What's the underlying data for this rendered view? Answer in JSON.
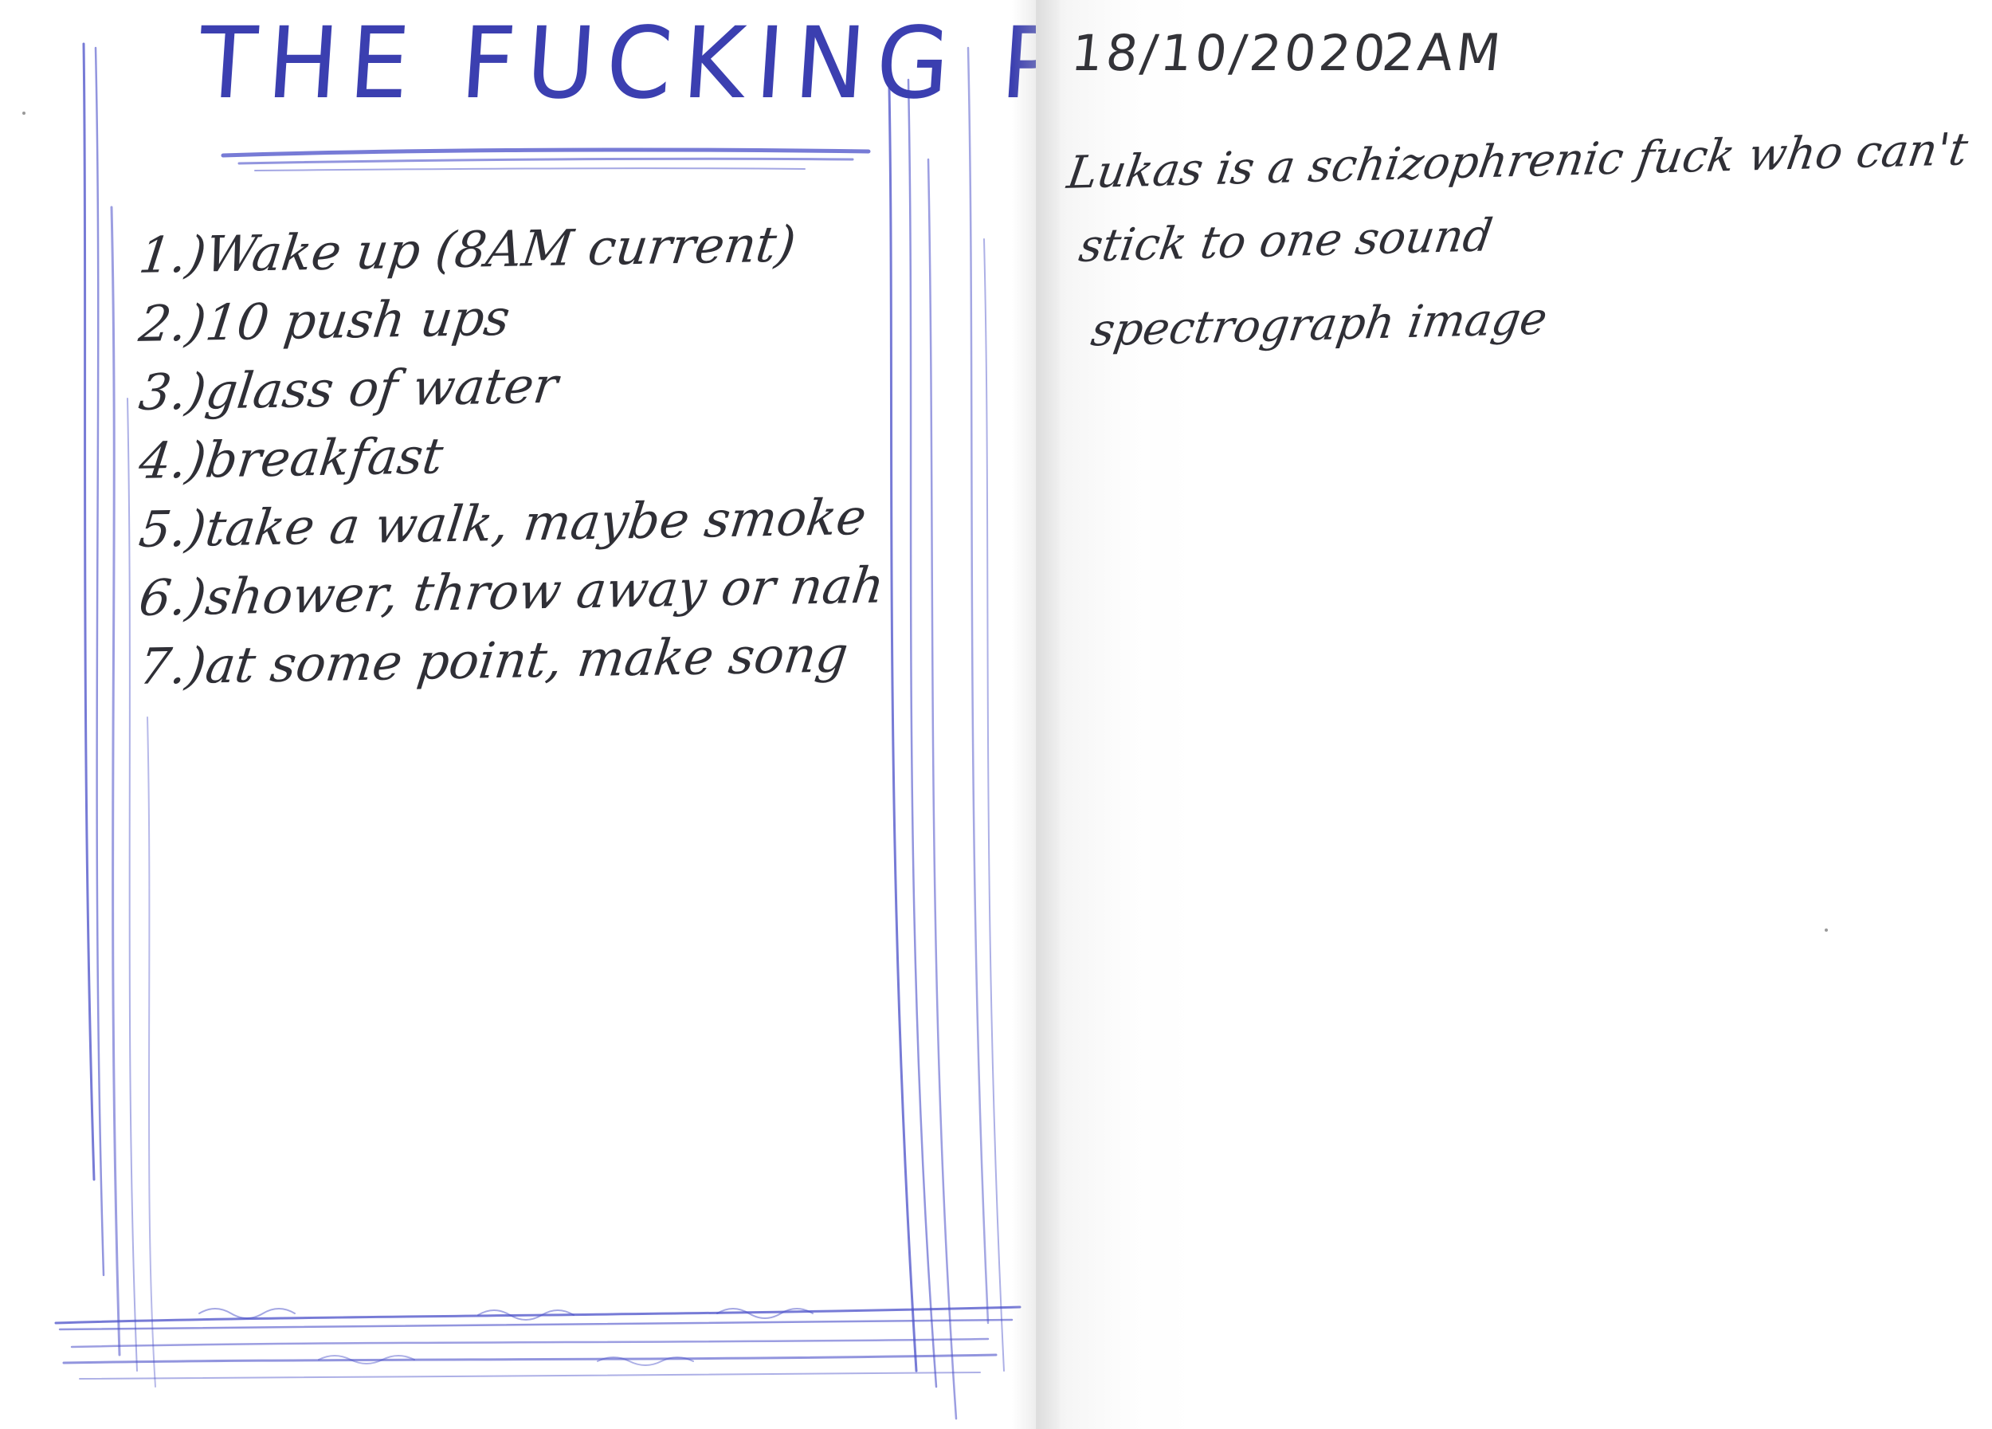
{
  "left_page": {
    "title": "THE FUCKING PLAN",
    "items": [
      {
        "num": "1.)",
        "text": "Wake up (8AM current)"
      },
      {
        "num": "2.)",
        "text": "10 push ups"
      },
      {
        "num": "3.)",
        "text": "glass of water"
      },
      {
        "num": "4.)",
        "text": "breakfast"
      },
      {
        "num": "5.)",
        "text": "take a walk, maybe smoke"
      },
      {
        "num": "6.)",
        "text": "shower, throw away or nah"
      },
      {
        "num": "7.)",
        "text": "at some point, make song"
      }
    ]
  },
  "right_page": {
    "date": "18/10/2020",
    "time": "2AM",
    "lines": [
      "Lukas is a schizophrenic fuck who can't",
      "stick to one sound",
      "spectrograph image"
    ]
  },
  "colors": {
    "blue_ink": "#3b3fb0",
    "pencil": "#2f2f36"
  }
}
